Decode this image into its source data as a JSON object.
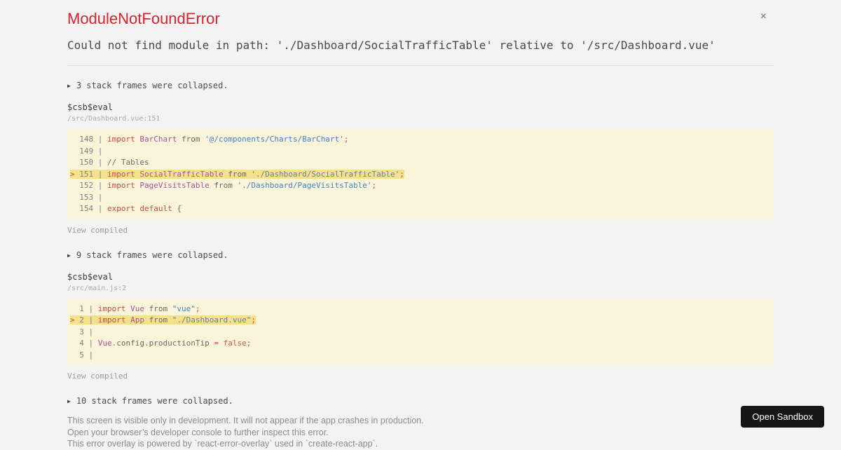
{
  "colors": {
    "page_background": "#f3f3f3",
    "error_title": "#d8232e",
    "code_block_background": "#f9f4da",
    "highlight_line_background": "#f3e28a",
    "token_keyword": "#cd4b42",
    "token_class": "#aa5499",
    "token_string": "#4183c4",
    "token_string_highlighted": "#66809b",
    "token_plain": "#696969",
    "token_boolean": "#c75b39",
    "button_background": "#161616"
  },
  "icons": {
    "close": "×",
    "expand_arrow": "▶"
  },
  "header": {
    "title": "ModuleNotFoundError"
  },
  "message": "Could not find module in path: './Dashboard/SocialTrafficTable' relative to '/src/Dashboard.vue'",
  "stack": {
    "collapsed": [
      "3 stack frames were collapsed.",
      "9 stack frames were collapsed.",
      "10 stack frames were collapsed."
    ],
    "frames": [
      {
        "fn": "$csb$eval",
        "location": "/src/Dashboard.vue:151",
        "view_compiled": "View compiled",
        "gutter": 3,
        "lines": [
          {
            "num": "148",
            "hl": false,
            "tokens": [
              [
                "import",
                "kw"
              ],
              [
                " ",
                "pl"
              ],
              [
                "BarChart",
                "cls"
              ],
              [
                " ",
                "pl"
              ],
              [
                "from",
                "pl"
              ],
              [
                " ",
                "pl"
              ],
              [
                "'@/components/Charts/BarChart'",
                "str"
              ],
              [
                ";",
                "kw"
              ]
            ]
          },
          {
            "num": "149",
            "hl": false,
            "tokens": []
          },
          {
            "num": "150",
            "hl": false,
            "tokens": [
              [
                "// Tables",
                "pl"
              ]
            ]
          },
          {
            "num": "151",
            "hl": true,
            "tokens": [
              [
                "import",
                "kw"
              ],
              [
                " ",
                "pl"
              ],
              [
                "SocialTrafficTable",
                "cls"
              ],
              [
                " ",
                "pl"
              ],
              [
                "from",
                "pl"
              ],
              [
                " ",
                "pl"
              ],
              [
                "'./Dashboard/SocialTrafficTable'",
                "strh"
              ],
              [
                ";",
                "kw"
              ]
            ]
          },
          {
            "num": "152",
            "hl": false,
            "tokens": [
              [
                "import",
                "kw"
              ],
              [
                " ",
                "pl"
              ],
              [
                "PageVisitsTable",
                "cls"
              ],
              [
                " ",
                "pl"
              ],
              [
                "from",
                "pl"
              ],
              [
                " ",
                "pl"
              ],
              [
                "'./Dashboard/PageVisitsTable'",
                "str"
              ],
              [
                ";",
                "kw"
              ]
            ]
          },
          {
            "num": "153",
            "hl": false,
            "tokens": []
          },
          {
            "num": "154",
            "hl": false,
            "tokens": [
              [
                "export",
                "kw"
              ],
              [
                " ",
                "pl"
              ],
              [
                "default",
                "kw"
              ],
              [
                " ",
                "pl"
              ],
              [
                "{",
                "pl"
              ]
            ]
          }
        ]
      },
      {
        "fn": "$csb$eval",
        "location": "/src/main.js:2",
        "view_compiled": "View compiled",
        "gutter": 1,
        "lines": [
          {
            "num": "1",
            "hl": false,
            "tokens": [
              [
                "import",
                "kw"
              ],
              [
                " ",
                "pl"
              ],
              [
                "Vue",
                "cls"
              ],
              [
                " ",
                "pl"
              ],
              [
                "from",
                "pl"
              ],
              [
                " ",
                "pl"
              ],
              [
                "\"vue\"",
                "str"
              ],
              [
                ";",
                "kw"
              ]
            ]
          },
          {
            "num": "2",
            "hl": true,
            "tokens": [
              [
                "import",
                "kw"
              ],
              [
                " ",
                "pl"
              ],
              [
                "App",
                "cls"
              ],
              [
                " ",
                "pl"
              ],
              [
                "from",
                "pl"
              ],
              [
                " ",
                "pl"
              ],
              [
                "\"./Dashboard.vue\"",
                "strh"
              ],
              [
                ";",
                "kw"
              ]
            ]
          },
          {
            "num": "3",
            "hl": false,
            "tokens": []
          },
          {
            "num": "4",
            "hl": false,
            "tokens": [
              [
                "Vue",
                "cls"
              ],
              [
                ".config.productionTip",
                "pl"
              ],
              [
                " ",
                "pl"
              ],
              [
                "=",
                "kw"
              ],
              [
                " ",
                "pl"
              ],
              [
                "false",
                "bool"
              ],
              [
                ";",
                "kw"
              ]
            ]
          },
          {
            "num": "5",
            "hl": false,
            "tokens": []
          }
        ]
      }
    ]
  },
  "footer": {
    "lines": [
      "This screen is visible only in development. It will not appear if the app crashes in production.",
      "Open your browser’s developer console to further inspect this error.",
      "This error overlay is powered by `react-error-overlay` used in `create-react-app`."
    ],
    "open_sandbox": "Open Sandbox"
  }
}
